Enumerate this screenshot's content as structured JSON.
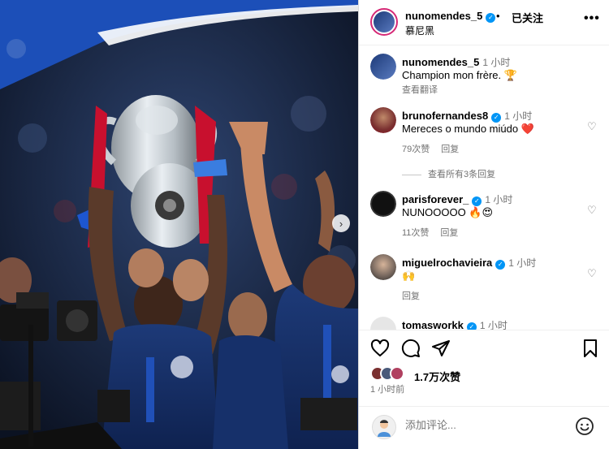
{
  "post": {
    "author": "nunomendes_5",
    "dot": "•",
    "follow_state": "已关注",
    "location": "慕尼黑",
    "more": "•••"
  },
  "caption": {
    "username": "nunomendes_5",
    "time": "1 小时",
    "text": "Champion mon frère. 🏆",
    "translate": "查看翻译"
  },
  "comments": [
    {
      "username": "brunofernandes8",
      "time": "1 小时",
      "text": "Mereces o mundo miúdo ❤️",
      "likes": "79次赞",
      "reply": "回复",
      "view_replies": "查看所有3条回复"
    },
    {
      "username": "parisforever_",
      "time": "1 小时",
      "text": "NUNOOOOO 🔥😍",
      "likes": "11次赞",
      "reply": "回复"
    },
    {
      "username": "miguelrochavieira",
      "time": "1 小时",
      "text": "🙌",
      "reply": "回复"
    },
    {
      "username": "tomasworkk",
      "time": "1 小时"
    }
  ],
  "likes_count": "1.7万次赞",
  "posted_ago": "1 小时前",
  "add_comment_placeholder": "添加评论...",
  "icons": {
    "like": "heart-icon",
    "comment": "comment-icon",
    "share": "share-icon",
    "save": "bookmark-icon",
    "emoji": "emoji-icon",
    "next": "chevron-right-icon"
  },
  "colors": {
    "verified": "#0095f6",
    "story_ring": "#d62976",
    "secondary_text": "#737373",
    "heart_red": "#e0245e"
  }
}
